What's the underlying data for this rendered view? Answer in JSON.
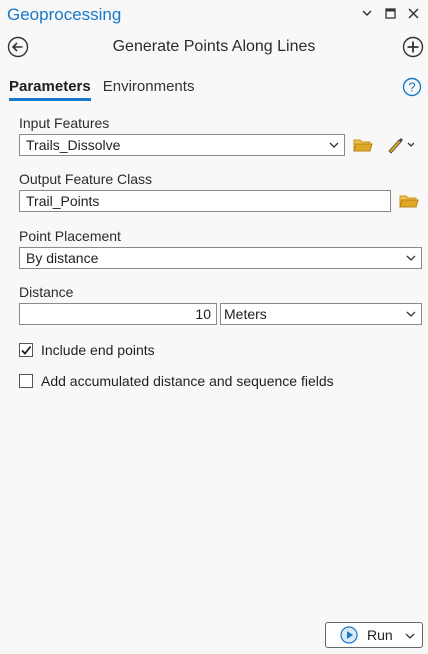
{
  "pane": {
    "title": "Geoprocessing",
    "controls": [
      "chevron-down-icon",
      "maximize-icon",
      "close-icon"
    ]
  },
  "tool": {
    "title": "Generate Points Along Lines"
  },
  "tabs": [
    {
      "label": "Parameters",
      "active": true
    },
    {
      "label": "Environments",
      "active": false
    }
  ],
  "params": {
    "input_features": {
      "label": "Input Features",
      "value": "Trails_Dissolve"
    },
    "output_class": {
      "label": "Output Feature Class",
      "value": "Trail_Points"
    },
    "point_placement": {
      "label": "Point Placement",
      "value": "By distance"
    },
    "distance": {
      "label": "Distance",
      "value": "10",
      "unit": "Meters"
    }
  },
  "options": [
    {
      "label": "Include end points",
      "checked": true
    },
    {
      "label": "Add accumulated distance and sequence fields",
      "checked": false
    }
  ],
  "run": {
    "label": "Run"
  },
  "colors": {
    "accent": "#1878c9",
    "folder": "#e0a723",
    "background": "#f8f8f8"
  }
}
